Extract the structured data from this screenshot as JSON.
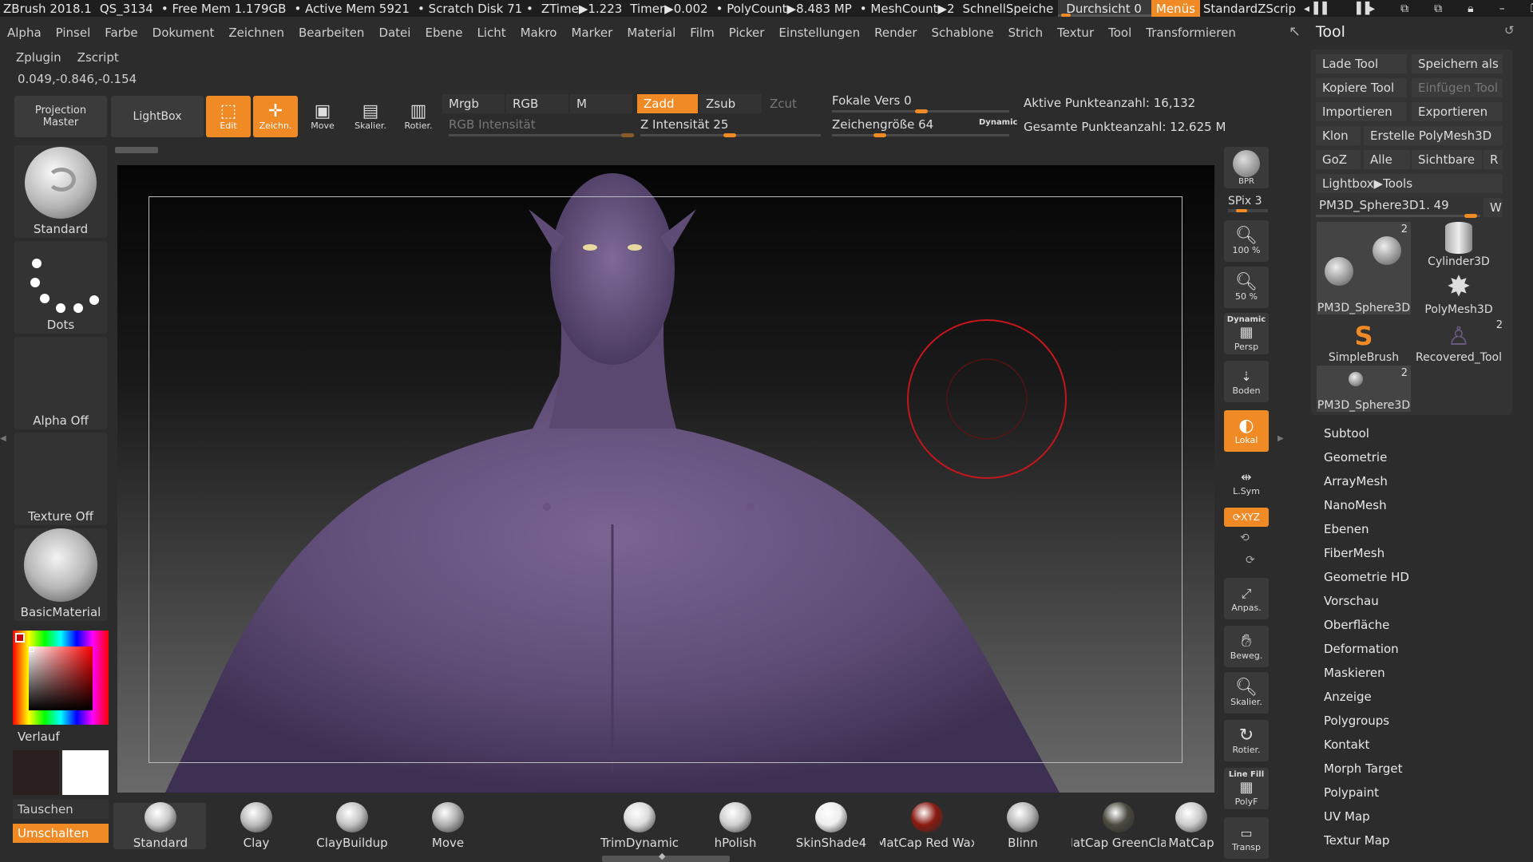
{
  "titlebar": {
    "app": "ZBrush 2018.1",
    "qs": "QS_3134",
    "free_mem": "• Free Mem 1.179GB",
    "active_mem": "• Active Mem 5921",
    "scratch": "• Scratch Disk 71 •",
    "ztime": "ZTime▶1.223",
    "timer": "Timer▶0.002",
    "polycount": "• PolyCount▶8.483 MP",
    "meshcount": "• MeshCount▶2",
    "quicksave": "SchnellSpeiche",
    "transparency": "Durchsicht 0",
    "menus": "Menüs",
    "script": "StandardZScrip"
  },
  "menubar": [
    "Alpha",
    "Pinsel",
    "Farbe",
    "Dokument",
    "Zeichnen",
    "Bearbeiten",
    "Datei",
    "Ebene",
    "Licht",
    "Makro",
    "Marker",
    "Material",
    "Film",
    "Picker",
    "Einstellungen",
    "Render",
    "Schablone",
    "Strich",
    "Textur",
    "Tool",
    "Transformieren"
  ],
  "menubar2": [
    "Zplugin",
    "Zscript"
  ],
  "coords": "0.049,-0.846,-0.154",
  "shelf": {
    "projection_master": "Projection Master",
    "lightbox": "LightBox",
    "edit": "Edit",
    "draw": "Zeichn.",
    "move": "Move",
    "scale": "Skalier.",
    "rotate": "Rotier.",
    "mrgb": "Mrgb",
    "rgb": "RGB",
    "m": "M",
    "zadd": "Zadd",
    "zsub": "Zsub",
    "zcut": "Zcut",
    "rgb_intensity": "RGB Intensität",
    "z_intensity": "Z Intensität 25",
    "focal": "Fokale Vers 0",
    "draw_size": "Zeichengröße 64",
    "dynamic": "Dynamic",
    "active_points": "Aktive Punkteanzahl: 16,132",
    "total_points": "Gesamte Punkteanzahl: 12.625 M"
  },
  "left": {
    "brush": "Standard",
    "stroke": "Dots",
    "alpha": "Alpha Off",
    "texture": "Texture Off",
    "material": "BasicMaterial",
    "gradient": "Verlauf",
    "swap": "Tauschen",
    "switch": "Umschalten"
  },
  "righttools": {
    "bpr": "BPR",
    "spix": "SPix 3",
    "zoom100": "100 %",
    "zoom50": "50 %",
    "dynamic": "Dynamic",
    "persp": "Persp",
    "floor": "Boden",
    "local": "Lokal",
    "lsym": "L.Sym",
    "xyz": "XYZ",
    "fit": "Anpas.",
    "move": "Beweg.",
    "scale": "Skalier.",
    "rotate": "Rotier.",
    "linefill": "Line Fill",
    "polyf": "PolyF",
    "transp": "Transp"
  },
  "toolpanel": {
    "title": "Tool",
    "load": "Lade Tool",
    "save_as": "Speichern als",
    "copy": "Kopiere Tool",
    "paste": "Einfügen Tool",
    "import": "Importieren",
    "export": "Exportieren",
    "clone": "Klon",
    "make_polymesh": "Erstelle PolyMesh3D",
    "goz": "GoZ",
    "all": "Alle",
    "visible": "Sichtbare",
    "r": "R",
    "lightbox_tools": "Lightbox▶Tools",
    "current_tool": "PM3D_Sphere3D1. 49",
    "w": "W",
    "thumbs": [
      {
        "label": "PM3D_Sphere3D",
        "count": "2"
      },
      {
        "label": "Cylinder3D",
        "count": ""
      },
      {
        "label": "PolyMesh3D",
        "count": ""
      },
      {
        "label": "SimpleBrush",
        "count": ""
      },
      {
        "label": "Recovered_Tool",
        "count": "2"
      },
      {
        "label": "PM3D_Sphere3D",
        "count": "2"
      }
    ],
    "subpalettes": [
      "Subtool",
      "Geometrie",
      "ArrayMesh",
      "NanoMesh",
      "Ebenen",
      "FiberMesh",
      "Geometrie HD",
      "Vorschau",
      "Oberfläche",
      "Deformation",
      "Maskieren",
      "Anzeige",
      "Polygroups",
      "Kontakt",
      "Morph Target",
      "Polypaint",
      "UV Map",
      "Textur Map"
    ]
  },
  "bottom_brushes": [
    "Standard",
    "Clay",
    "ClayBuildup",
    "Move",
    "TrimDynamic",
    "hPolish",
    "SkinShade4",
    "MatCap Red Wax",
    "Blinn",
    "MatCap GreenClay",
    "MatCap"
  ],
  "colors": {
    "accent": "#f08a24",
    "model": "#5e4c76",
    "brush_circle": "#c4161c"
  }
}
